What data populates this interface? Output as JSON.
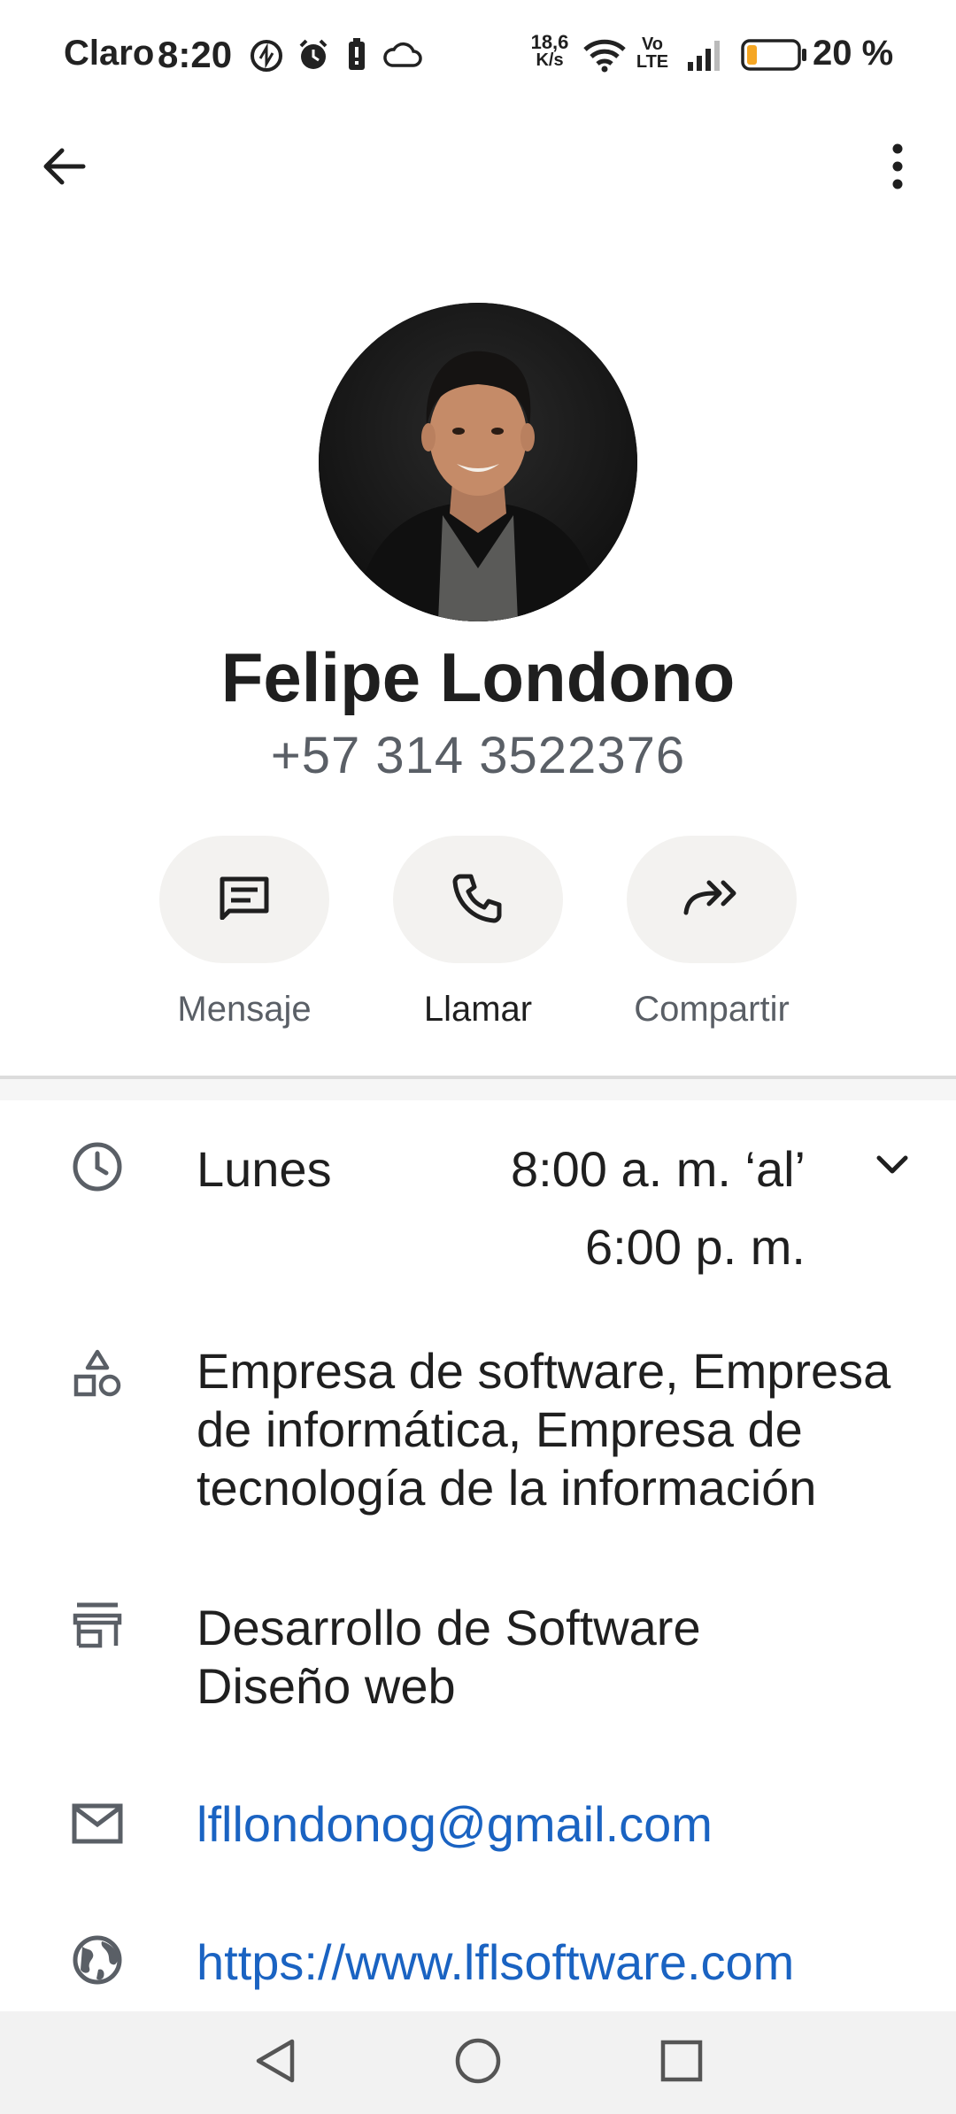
{
  "status_bar": {
    "carrier": "Claro",
    "time": "8:20",
    "net_speed_top": "18,6",
    "net_speed_bottom": "K/s",
    "volte_top": "Vo",
    "volte_bottom": "LTE",
    "battery_percent": "20 %",
    "battery_level": 0.2,
    "icons": [
      "data-saver-icon",
      "alarm-icon",
      "battery-saver-icon",
      "cloud-icon",
      "wifi-icon",
      "signal-icon",
      "battery-icon"
    ]
  },
  "top_bar": {
    "back_icon": "arrow-left-icon",
    "menu_icon": "more-vert-icon"
  },
  "contact": {
    "name": "Felipe Londono",
    "phone": "+57 314 3522376"
  },
  "actions": [
    {
      "label": "Mensaje",
      "icon": "message-icon"
    },
    {
      "label": "Llamar",
      "icon": "phone-icon"
    },
    {
      "label": "Compartir",
      "icon": "share-icon"
    }
  ],
  "details": {
    "hours": {
      "day": "Lunes",
      "time_line1": "8:00 a. m. ‘al’",
      "time_line2": "6:00 p. m.",
      "icon": "clock-icon"
    },
    "categories": {
      "lines": [
        "Empresa de software, Empresa",
        "de informática, Empresa de",
        "tecnología de la información"
      ],
      "icon": "category-icon"
    },
    "services": {
      "lines": [
        "Desarrollo de Software",
        "Diseño web"
      ],
      "icon": "store-icon"
    },
    "email": {
      "value": "lfllondonog@gmail.com",
      "icon": "mail-icon"
    },
    "website": {
      "value": "https://www.lflsoftware.com",
      "icon": "globe-icon"
    }
  },
  "colors": {
    "link": "#1a63c2",
    "action_bg": "#f3f2f0",
    "battery_fill": "#f5a623"
  },
  "nav_bar": {
    "icons": [
      "back-triangle-icon",
      "home-circle-icon",
      "recents-square-icon"
    ]
  }
}
